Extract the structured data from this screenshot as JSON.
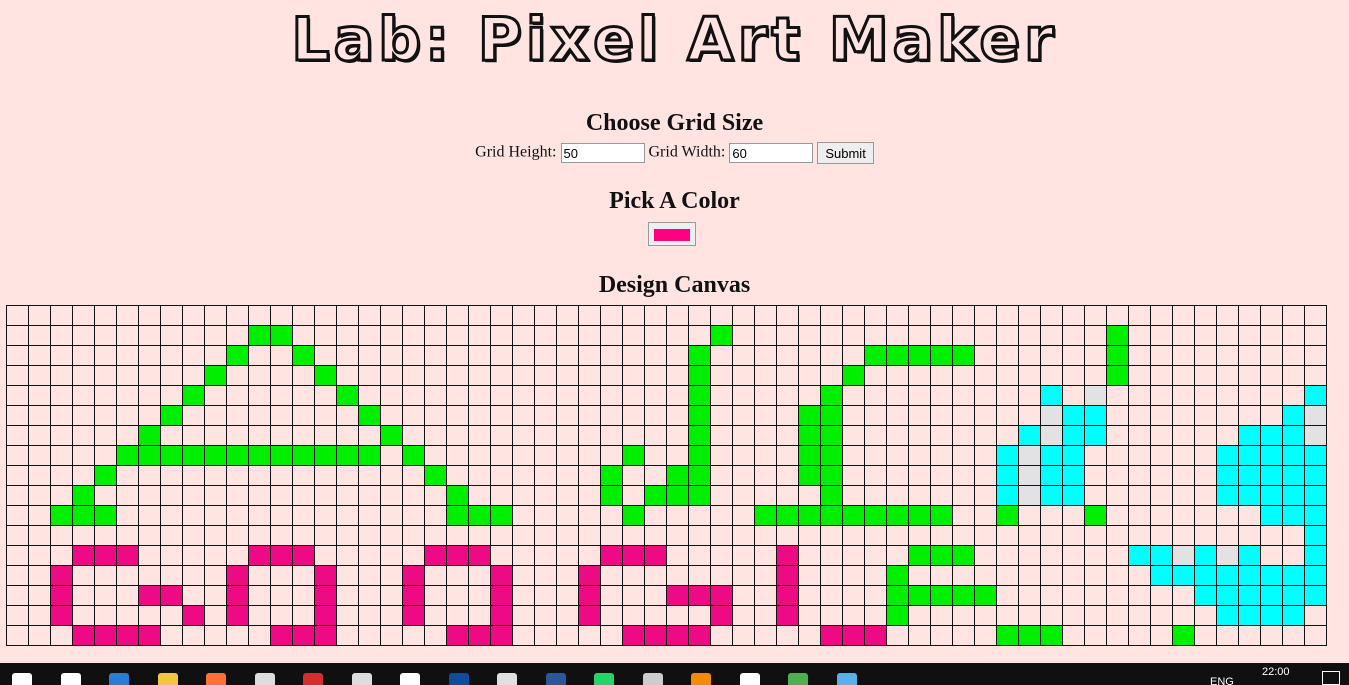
{
  "header": {
    "title": "Lab: Pixel Art Maker"
  },
  "grid_form": {
    "heading": "Choose Grid Size",
    "height_label": "Grid Height:",
    "height_value": "50",
    "width_label": "Grid Width:",
    "width_value": "60",
    "submit_label": "Submit"
  },
  "color_picker": {
    "heading": "Pick A Color",
    "value": "#ff0080"
  },
  "canvas": {
    "heading": "Design Canvas",
    "background": "#ffe4e1",
    "palette": {
      "1": "#00ee00",
      "2": "#ee0a84",
      "3": "#00ffff",
      "4": "#e2e2e4"
    },
    "rows": [
      "..............................................................",
      "...........##...................+.................#...........",
      "..........#..#.................#.......#####......#...........",
      ".........#....#................#......#...........#...........",
      "........#......#...............#.....#.........~.~.........~~~",
      ".......#........#..............#....##.........~~~........~~~~",
      "......#..........#.............#....##........~~~~......~~~~~~",
      ".....############.#.........#..#....##.......~~~~......~~~~~~~",
      "....#..............#.......#..##....##.......~~~~......~~~~~~~",
      "...#................#......#.###.....#.......~~~~......~~~~~~~",
      "..###...............###.....#.....#########..#...#.......~~~~~",
      "...........................................................~..",
      "...###.....###.....###.....###.....#.....###.......~~~~~~..~~.",
      "..#.......#...#...#...#...#........#....#...........~~~~~~~~..",
      "..#...##..#...#...#...#...#...###..#....#####.........~~~~~~..",
      "..#.....#.#...#...#...#...#.....#..#....#..............~~~~...",
      "...####.....###.....###.....####.....###.....###.....#........",
      ".....................................................#........",
      ".............................................................."
    ]
  },
  "taskbar": {
    "icons": [
      "windows-start",
      "search",
      "edge",
      "file-explorer",
      "firefox",
      "store",
      "acrobat",
      "apps",
      "hp",
      "photoshop",
      "chrome",
      "word",
      "whatsapp",
      "paint",
      "vlc",
      "notes",
      "globe",
      "photos"
    ],
    "tray_lang": "ENG",
    "clock": "22:00"
  }
}
